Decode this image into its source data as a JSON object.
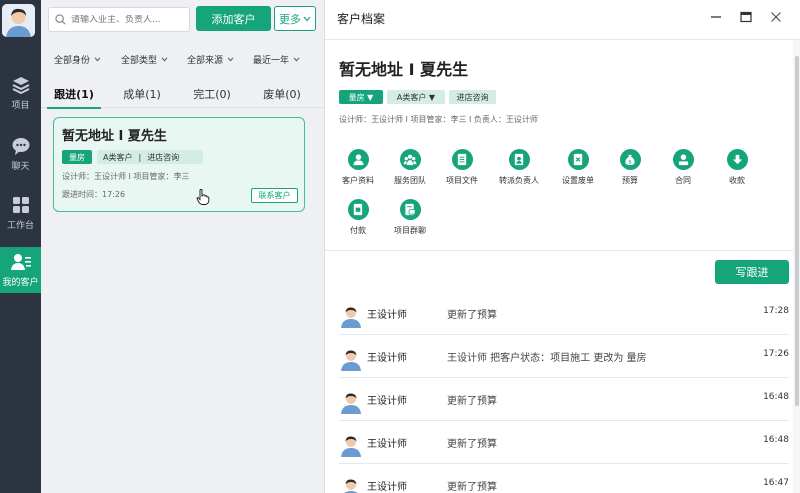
{
  "sidebar": {
    "items": [
      {
        "label": "项目",
        "icon": "layers-icon"
      },
      {
        "label": "聊天",
        "icon": "chat-icon"
      },
      {
        "label": "工作台",
        "icon": "grid-icon"
      },
      {
        "label": "我的客户",
        "icon": "customer-icon"
      }
    ],
    "active_color": "#16a47a"
  },
  "toolbar": {
    "search_placeholder": "请输入业主、负责人...",
    "add_label": "添加客户",
    "more_label": "更多"
  },
  "filters": [
    {
      "label": "全部身份"
    },
    {
      "label": "全部类型"
    },
    {
      "label": "全部来源"
    },
    {
      "label": "最近一年"
    }
  ],
  "tabs": [
    {
      "label": "跟进(1)"
    },
    {
      "label": "成单(1)"
    },
    {
      "label": "完工(0)"
    },
    {
      "label": "废单(0)"
    }
  ],
  "card": {
    "title": "暂无地址 Ι 夏先生",
    "tag_status": "量房",
    "tag_grade": "A类客户",
    "tag_sep": "|",
    "tag_source": "进店咨询",
    "meta": "设计师：王设计师 Ι 项目管家：李三",
    "time": "跟进时间：17:26",
    "contact_label": "联系客户"
  },
  "detail": {
    "window_title": "客户档案",
    "name": "暂无地址 Ι 夏先生",
    "tag_status": "量房 ▼",
    "tag_grade": "A类客户 ▼",
    "tag_source": "进店咨询",
    "meta": "设计师：王设计师 Ι 项目管家：李三 Ι 负责人：王设计师",
    "actions": [
      {
        "label": "客户资料",
        "icon": "profile-icon"
      },
      {
        "label": "服务团队",
        "icon": "team-icon"
      },
      {
        "label": "项目文件",
        "icon": "file-icon"
      },
      {
        "label": "转派负责人",
        "icon": "transfer-icon"
      },
      {
        "label": "设置废单",
        "icon": "void-icon"
      },
      {
        "label": "预算",
        "icon": "budget-icon"
      },
      {
        "label": "合同",
        "icon": "contract-icon"
      },
      {
        "label": "收款",
        "icon": "receive-icon"
      },
      {
        "label": "付款",
        "icon": "pay-icon"
      },
      {
        "label": "项目群聊",
        "icon": "group-chat-icon"
      }
    ],
    "write_label": "写跟进",
    "feed": [
      {
        "user": "王设计师",
        "text": "更新了预算",
        "time": "17:28"
      },
      {
        "user": "王设计师",
        "text": "王设计师 把客户状态：项目施工 更改为 量房",
        "time": "17:26"
      },
      {
        "user": "王设计师",
        "text": "更新了预算",
        "time": "16:48"
      },
      {
        "user": "王设计师",
        "text": "更新了预算",
        "time": "16:48"
      },
      {
        "user": "王设计师",
        "text": "更新了预算",
        "time": "16:47"
      }
    ]
  }
}
